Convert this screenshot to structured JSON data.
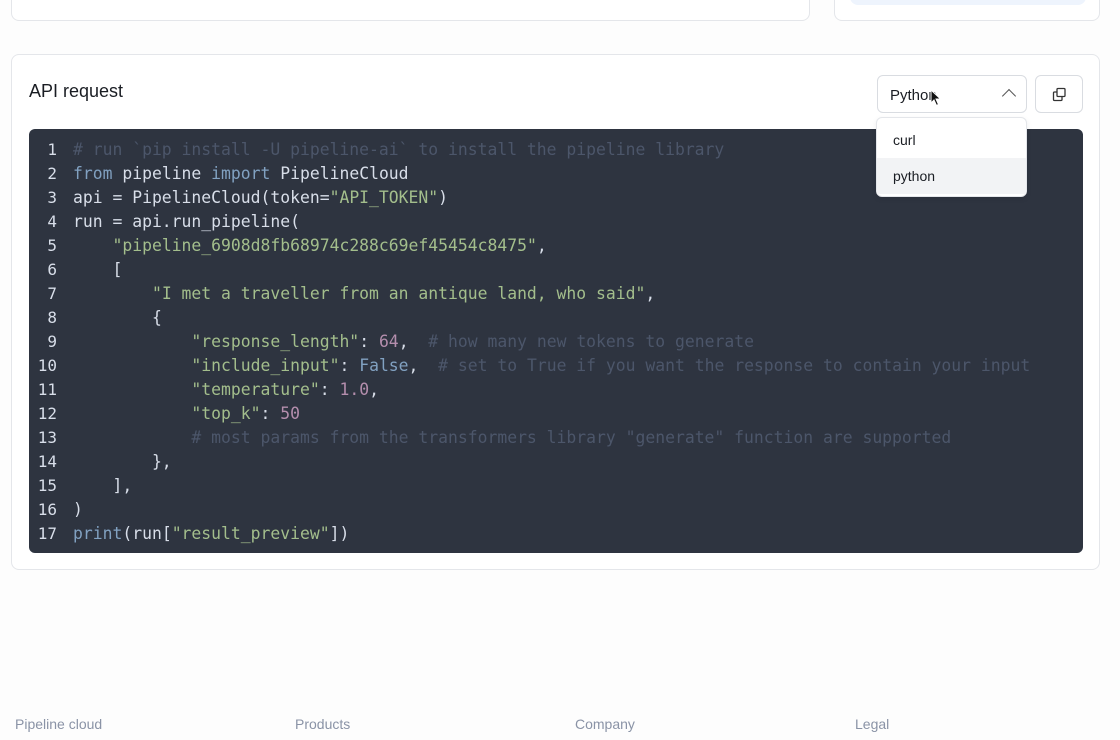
{
  "api_request": {
    "title": "API request",
    "language_select": {
      "value": "Python",
      "options": [
        "curl",
        "python"
      ],
      "highlighted": "python",
      "open": true
    },
    "copy_icon": "copy-icon",
    "code_lines": [
      [
        [
          "c",
          "# run `pip install -U pipeline-ai` to install the pipeline library"
        ]
      ],
      [
        [
          "k",
          "from"
        ],
        [
          "t",
          " pipeline "
        ],
        [
          "k",
          "import"
        ],
        [
          "t",
          " PipelineCloud"
        ]
      ],
      [
        [
          "t",
          "api = PipelineCloud(token="
        ],
        [
          "s",
          "\"API_TOKEN\""
        ],
        [
          "t",
          ")"
        ]
      ],
      [
        [
          "t",
          "run = api.run_pipeline("
        ]
      ],
      [
        [
          "t",
          "    "
        ],
        [
          "s",
          "\"pipeline_6908d8fb68974c288c69ef45454c8475\""
        ],
        [
          "t",
          ","
        ]
      ],
      [
        [
          "t",
          "    ["
        ]
      ],
      [
        [
          "t",
          "        "
        ],
        [
          "s",
          "\"I met a traveller from an antique land, who said\""
        ],
        [
          "t",
          ","
        ]
      ],
      [
        [
          "t",
          "        {"
        ]
      ],
      [
        [
          "t",
          "            "
        ],
        [
          "s",
          "\"response_length\""
        ],
        [
          "t",
          ": "
        ],
        [
          "n",
          "64"
        ],
        [
          "t",
          ",  "
        ],
        [
          "c",
          "# how many new tokens to generate"
        ]
      ],
      [
        [
          "t",
          "            "
        ],
        [
          "s",
          "\"include_input\""
        ],
        [
          "t",
          ": "
        ],
        [
          "k",
          "False"
        ],
        [
          "t",
          ",  "
        ],
        [
          "c",
          "# set to True if you want the response to contain your input"
        ]
      ],
      [
        [
          "t",
          "            "
        ],
        [
          "s",
          "\"temperature\""
        ],
        [
          "t",
          ": "
        ],
        [
          "n",
          "1.0"
        ],
        [
          "t",
          ","
        ]
      ],
      [
        [
          "t",
          "            "
        ],
        [
          "s",
          "\"top_k\""
        ],
        [
          "t",
          ": "
        ],
        [
          "n",
          "50"
        ]
      ],
      [
        [
          "t",
          "            "
        ],
        [
          "c",
          "# most params from the transformers library \"generate\" function are supported"
        ]
      ],
      [
        [
          "t",
          "        },"
        ]
      ],
      [
        [
          "t",
          "    ],"
        ]
      ],
      [
        [
          "t",
          ")"
        ]
      ],
      [
        [
          "k",
          "print"
        ],
        [
          "t",
          "(run["
        ],
        [
          "s",
          "\"result_preview\""
        ],
        [
          "t",
          "])"
        ]
      ]
    ]
  },
  "footer": {
    "columns": [
      "Pipeline cloud",
      "Products",
      "Company",
      "Legal"
    ]
  },
  "colors": {
    "code_bg": "#2e3440",
    "comment": "#4c566a",
    "keyword": "#81a1c1",
    "string": "#a3be8c",
    "number": "#b48ead"
  }
}
